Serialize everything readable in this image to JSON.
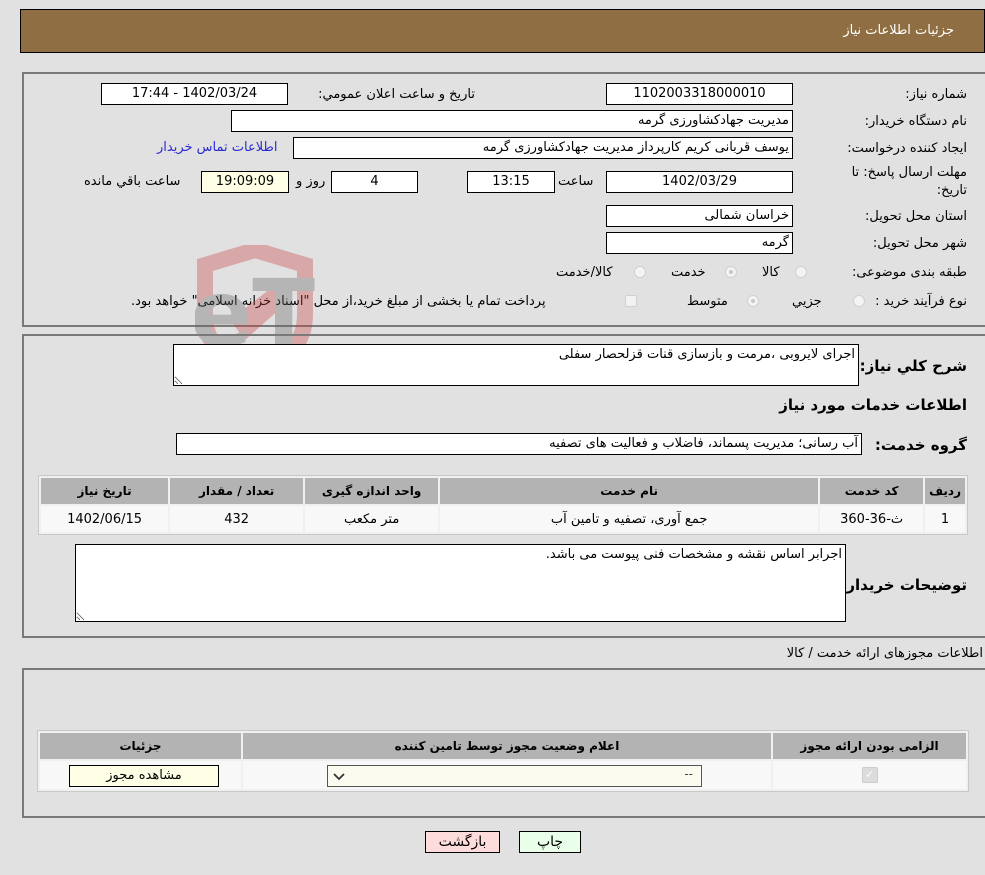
{
  "header": {
    "title": "جزئیات اطلاعات نیاز"
  },
  "fields": {
    "need_number_label": "شماره نیاز:",
    "need_number": "1102003318000010",
    "announce_label": "تاریخ و ساعت اعلان عمومي:",
    "announce_value": "1402/03/24 - 17:44",
    "buyer_org_label": "نام دستگاه خریدار:",
    "buyer_org": "مدیریت جهادکشاورزی گرمه",
    "creator_label": "ایجاد کننده درخواست:",
    "creator": "یوسف قربانی کریم کارپرداز مدیریت جهادکشاورزی گرمه",
    "contact_link": "اطلاعات تماس خریدار",
    "deadline_label_1": "مهلت ارسال پاسخ: تا",
    "deadline_label_2": "تاریخ:",
    "deadline_date": "1402/03/29",
    "time_label": "ساعت",
    "deadline_time": "13:15",
    "days_value": "4",
    "days_label": "روز و",
    "remaining_time": "19:09:09",
    "remaining_label": "ساعت باقي مانده",
    "province_label": "استان محل تحویل:",
    "province": "خراسان شمالی",
    "city_label": "شهر محل تحویل:",
    "city": "گرمه",
    "category_label": "طبقه بندی موضوعی:",
    "category_options": [
      "کالا",
      "خدمت",
      "کالا/خدمت"
    ],
    "category_selected": "خدمت",
    "process_label": "نوع فرآیند خرید :",
    "process_options": [
      "جزیي",
      "متوسط"
    ],
    "process_selected": "متوسط",
    "treasury_note": "پرداخت تمام یا بخشی از مبلغ خرید،از محل \"اسناد خزانه اسلامی\" خواهد بود."
  },
  "description": {
    "label": "شرح کلي نیاز:",
    "value": "اجرای لایروبی ،مرمت و بازسازی قنات قزلحصار سفلی"
  },
  "services": {
    "section_title": "اطلاعات خدمات مورد نیاز",
    "group_label": "گروه خدمت:",
    "group_value": "آب رسانی؛ مدیریت پسماند، فاضلاب و فعالیت های تصفیه",
    "columns": [
      "ردیف",
      "کد خدمت",
      "نام خدمت",
      "واحد اندازه گیری",
      "تعداد / مقدار",
      "تاریخ نیاز"
    ],
    "rows": [
      {
        "index": "1",
        "code": "ث-36-360",
        "name": "جمع آوری، تصفیه و تامین آب",
        "unit": "متر مکعب",
        "qty": "432",
        "date": "1402/06/15"
      }
    ]
  },
  "buyer_notes": {
    "label": "توضیحات خریدار:",
    "value": "اجرابر اساس نقشه و مشخصات فنی پیوست می باشد."
  },
  "permits": {
    "section_title": "اطلاعات مجوزهای ارائه خدمت / کالا",
    "columns": [
      "الزامی بودن ارائه مجوز",
      "اعلام وضعیت مجوز توسط تامین کننده",
      "جزئیات"
    ],
    "row": {
      "required_checked": true,
      "status_value": "--",
      "details_button": "مشاهده مجوز"
    }
  },
  "buttons": {
    "print": "چاپ",
    "back": "بازگشت"
  },
  "watermark": "AriaTender.neT"
}
